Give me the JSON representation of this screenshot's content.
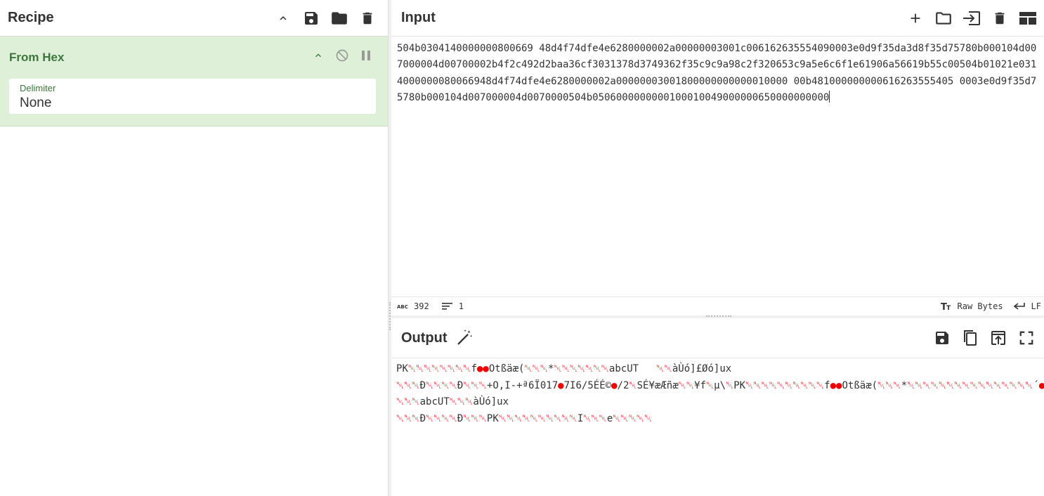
{
  "recipe": {
    "title": "Recipe",
    "operation": {
      "name": "From Hex",
      "delimiter_label": "Delimiter",
      "delimiter_value": "None"
    }
  },
  "input": {
    "title": "Input",
    "text": "504b0304140000000800669 48d4f74dfe4e6280000002a00000003001c006162635554090003e0d9f35da3d8f35d75780b000104d007000004d00700002b4f2c492d2baa36cf3031378d3749362f35c9c9a98c2f320653c9a5e6c6f1e61906a56619b55c00504b01021e0314000000080066948d4f74dfe4e6280000002a00000003001800000000000010000 00b481000000000616263555405 0003e0d9f35d75780b000104d007000004d0070000504b0506000000000100010049000000650000000000",
    "char_count": "392",
    "line_count": "1",
    "encoding": "Raw Bytes",
    "eol": "LF"
  },
  "output": {
    "title": "Output",
    "lines": [
      "PK␀␀␀␀␀␀␀␀f●●Otßäæ(␀␀␀*␀␀␀␀␀␀␀abcUT   ␀␀àÙó]£Øó]ux",
      "␀␀␀Ð␀␀␀␀Ð␀␀␀+O,I-+ª6Ï017●7I6/5ÉÉ©●/2␀SÉ¥æÆñæ␀␀¥f␀µ\\␀PK␀␀␀␀␀␀␀␀␀␀f●●Otßäæ(␀␀␀*␀␀␀␀␀␀␀␀␀␀␀␀␀␀␀␀´●␀",
      "␀␀␀abcUT␀␀␀àÙó]ux",
      "␀␀␀Ð␀␀␀␀Ð␀␀␀PK␀␀␀␀␀␀␀␀␀␀I␀␀␀e␀␀␀␀␀"
    ]
  }
}
